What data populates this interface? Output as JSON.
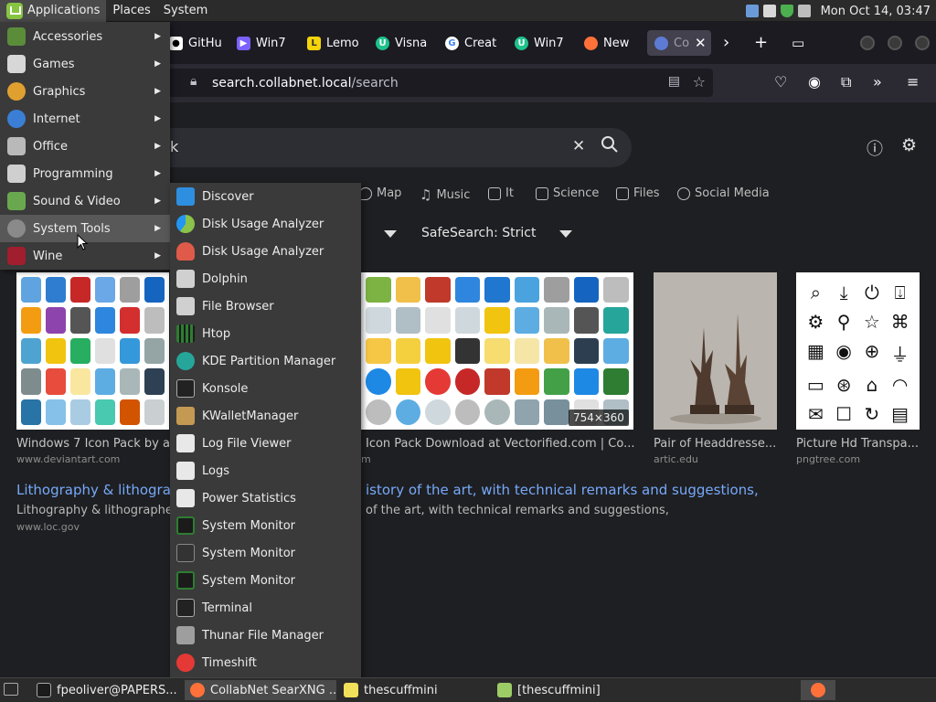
{
  "top_panel": {
    "menus": [
      "Applications",
      "Places",
      "System"
    ],
    "clock": "Mon Oct 14, 03:47"
  },
  "browser": {
    "tabs": [
      {
        "label": "GitHu",
        "icon": "github-icon",
        "color": "#ffffff"
      },
      {
        "label": "Win7",
        "icon": "play-icon",
        "color": "#7b61ff"
      },
      {
        "label": "Lemo",
        "icon": "lemon-icon",
        "color": "#f5d50a"
      },
      {
        "label": "Visna",
        "icon": "u-icon",
        "color": "#1ec28b"
      },
      {
        "label": "Creat",
        "icon": "google-icon",
        "color": "#ffffff"
      },
      {
        "label": "Win7",
        "icon": "u-icon",
        "color": "#1ec28b"
      },
      {
        "label": "New",
        "icon": "firefox-icon",
        "color": "#ff7139"
      },
      {
        "label": "Co",
        "icon": "searxng-icon",
        "color": "#5d7bd5"
      }
    ],
    "url": {
      "host": "search.collabnet.local",
      "path": "/search"
    }
  },
  "page": {
    "search_value": "k",
    "categories": [
      "Map",
      "Music",
      "It",
      "Science",
      "Files",
      "Social Media"
    ],
    "safesearch": "SafeSearch: Strict",
    "results": [
      {
        "title": "Windows 7 Icon Pack by a",
        "url": "www.deviantart.com"
      },
      {
        "title": "Icon Pack Download at Vectorified.com | Co...",
        "url": "m"
      },
      {
        "title": "Pair of Headdresse...",
        "url": "artic.edu"
      },
      {
        "title": "Picture Hd Transpa...",
        "url": "pngtree.com"
      }
    ],
    "size_badge": "754×360",
    "link_title_left": "Lithography & lithograp",
    "link_title_right": "istory of the art, with technical remarks and suggestions,",
    "snippet_left": "Lithography & lithographe",
    "snippet_right": "of the art, with technical remarks and suggestions,",
    "snippet_url": "www.loc.gov"
  },
  "app_menu": [
    {
      "label": "Accessories",
      "icon": "accessories-icon",
      "color": "#5b8c3a"
    },
    {
      "label": "Games",
      "icon": "games-icon",
      "color": "#d7d7d7"
    },
    {
      "label": "Graphics",
      "icon": "graphics-icon",
      "color": "#e0a030"
    },
    {
      "label": "Internet",
      "icon": "internet-icon",
      "color": "#3a7fd5"
    },
    {
      "label": "Office",
      "icon": "office-icon",
      "color": "#b9b9b9"
    },
    {
      "label": "Programming",
      "icon": "programming-icon",
      "color": "#cfcfcf"
    },
    {
      "label": "Sound & Video",
      "icon": "sound-video-icon",
      "color": "#6aa84f"
    },
    {
      "label": "System Tools",
      "icon": "system-tools-icon",
      "color": "#8a8a8a"
    },
    {
      "label": "Wine",
      "icon": "wine-icon",
      "color": "#a01e2e"
    }
  ],
  "sub_menu": [
    {
      "label": "Discover",
      "icon": "discover-icon",
      "color": "#2e8fe0"
    },
    {
      "label": "Disk Usage Analyzer",
      "icon": "disk-usage-icon",
      "color": "#8bc34a"
    },
    {
      "label": "Disk Usage Analyzer",
      "icon": "disk-usage-icon",
      "color": "#e05a4a"
    },
    {
      "label": "Dolphin",
      "icon": "dolphin-icon",
      "color": "#d0d0d0"
    },
    {
      "label": "File Browser",
      "icon": "file-browser-icon",
      "color": "#d0d0d0"
    },
    {
      "label": "Htop",
      "icon": "htop-icon",
      "color": "#2e7d32"
    },
    {
      "label": "KDE Partition Manager",
      "icon": "partition-icon",
      "color": "#26a69a"
    },
    {
      "label": "Konsole",
      "icon": "konsole-icon",
      "color": "#222222"
    },
    {
      "label": "KWalletManager",
      "icon": "kwallet-icon",
      "color": "#c49a52"
    },
    {
      "label": "Log File Viewer",
      "icon": "log-viewer-icon",
      "color": "#e8e8e8"
    },
    {
      "label": "Logs",
      "icon": "logs-icon",
      "color": "#e8e8e8"
    },
    {
      "label": "Power Statistics",
      "icon": "power-stats-icon",
      "color": "#e8e8e8"
    },
    {
      "label": "System Monitor",
      "icon": "system-monitor-icon",
      "color": "#2e7d32"
    },
    {
      "label": "System Monitor",
      "icon": "system-monitor-icon",
      "color": "#333333"
    },
    {
      "label": "System Monitor",
      "icon": "system-monitor-icon",
      "color": "#2e7d32"
    },
    {
      "label": "Terminal",
      "icon": "terminal-icon",
      "color": "#222222"
    },
    {
      "label": "Thunar File Manager",
      "icon": "thunar-icon",
      "color": "#9e9e9e"
    },
    {
      "label": "Timeshift",
      "icon": "timeshift-icon",
      "color": "#e53935"
    }
  ],
  "taskbar": [
    {
      "label": "fpeoliver@PAPERS...",
      "icon": "terminal-icon"
    },
    {
      "label": "CollabNet SearXNG ...",
      "icon": "firefox-icon"
    },
    {
      "label": "thescuffmini",
      "icon": "document-icon"
    },
    {
      "label": "[thescuffmini]",
      "icon": "document-icon"
    }
  ]
}
